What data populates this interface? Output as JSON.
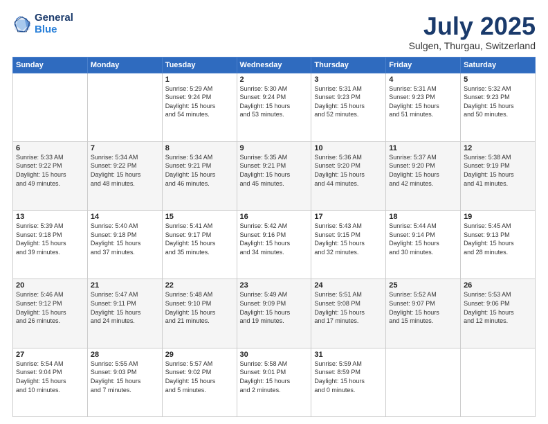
{
  "header": {
    "logo_line1": "General",
    "logo_line2": "Blue",
    "month": "July 2025",
    "location": "Sulgen, Thurgau, Switzerland"
  },
  "days_of_week": [
    "Sunday",
    "Monday",
    "Tuesday",
    "Wednesday",
    "Thursday",
    "Friday",
    "Saturday"
  ],
  "weeks": [
    [
      {
        "day": "",
        "info": ""
      },
      {
        "day": "",
        "info": ""
      },
      {
        "day": "1",
        "info": "Sunrise: 5:29 AM\nSunset: 9:24 PM\nDaylight: 15 hours\nand 54 minutes."
      },
      {
        "day": "2",
        "info": "Sunrise: 5:30 AM\nSunset: 9:24 PM\nDaylight: 15 hours\nand 53 minutes."
      },
      {
        "day": "3",
        "info": "Sunrise: 5:31 AM\nSunset: 9:23 PM\nDaylight: 15 hours\nand 52 minutes."
      },
      {
        "day": "4",
        "info": "Sunrise: 5:31 AM\nSunset: 9:23 PM\nDaylight: 15 hours\nand 51 minutes."
      },
      {
        "day": "5",
        "info": "Sunrise: 5:32 AM\nSunset: 9:23 PM\nDaylight: 15 hours\nand 50 minutes."
      }
    ],
    [
      {
        "day": "6",
        "info": "Sunrise: 5:33 AM\nSunset: 9:22 PM\nDaylight: 15 hours\nand 49 minutes."
      },
      {
        "day": "7",
        "info": "Sunrise: 5:34 AM\nSunset: 9:22 PM\nDaylight: 15 hours\nand 48 minutes."
      },
      {
        "day": "8",
        "info": "Sunrise: 5:34 AM\nSunset: 9:21 PM\nDaylight: 15 hours\nand 46 minutes."
      },
      {
        "day": "9",
        "info": "Sunrise: 5:35 AM\nSunset: 9:21 PM\nDaylight: 15 hours\nand 45 minutes."
      },
      {
        "day": "10",
        "info": "Sunrise: 5:36 AM\nSunset: 9:20 PM\nDaylight: 15 hours\nand 44 minutes."
      },
      {
        "day": "11",
        "info": "Sunrise: 5:37 AM\nSunset: 9:20 PM\nDaylight: 15 hours\nand 42 minutes."
      },
      {
        "day": "12",
        "info": "Sunrise: 5:38 AM\nSunset: 9:19 PM\nDaylight: 15 hours\nand 41 minutes."
      }
    ],
    [
      {
        "day": "13",
        "info": "Sunrise: 5:39 AM\nSunset: 9:18 PM\nDaylight: 15 hours\nand 39 minutes."
      },
      {
        "day": "14",
        "info": "Sunrise: 5:40 AM\nSunset: 9:18 PM\nDaylight: 15 hours\nand 37 minutes."
      },
      {
        "day": "15",
        "info": "Sunrise: 5:41 AM\nSunset: 9:17 PM\nDaylight: 15 hours\nand 35 minutes."
      },
      {
        "day": "16",
        "info": "Sunrise: 5:42 AM\nSunset: 9:16 PM\nDaylight: 15 hours\nand 34 minutes."
      },
      {
        "day": "17",
        "info": "Sunrise: 5:43 AM\nSunset: 9:15 PM\nDaylight: 15 hours\nand 32 minutes."
      },
      {
        "day": "18",
        "info": "Sunrise: 5:44 AM\nSunset: 9:14 PM\nDaylight: 15 hours\nand 30 minutes."
      },
      {
        "day": "19",
        "info": "Sunrise: 5:45 AM\nSunset: 9:13 PM\nDaylight: 15 hours\nand 28 minutes."
      }
    ],
    [
      {
        "day": "20",
        "info": "Sunrise: 5:46 AM\nSunset: 9:12 PM\nDaylight: 15 hours\nand 26 minutes."
      },
      {
        "day": "21",
        "info": "Sunrise: 5:47 AM\nSunset: 9:11 PM\nDaylight: 15 hours\nand 24 minutes."
      },
      {
        "day": "22",
        "info": "Sunrise: 5:48 AM\nSunset: 9:10 PM\nDaylight: 15 hours\nand 21 minutes."
      },
      {
        "day": "23",
        "info": "Sunrise: 5:49 AM\nSunset: 9:09 PM\nDaylight: 15 hours\nand 19 minutes."
      },
      {
        "day": "24",
        "info": "Sunrise: 5:51 AM\nSunset: 9:08 PM\nDaylight: 15 hours\nand 17 minutes."
      },
      {
        "day": "25",
        "info": "Sunrise: 5:52 AM\nSunset: 9:07 PM\nDaylight: 15 hours\nand 15 minutes."
      },
      {
        "day": "26",
        "info": "Sunrise: 5:53 AM\nSunset: 9:06 PM\nDaylight: 15 hours\nand 12 minutes."
      }
    ],
    [
      {
        "day": "27",
        "info": "Sunrise: 5:54 AM\nSunset: 9:04 PM\nDaylight: 15 hours\nand 10 minutes."
      },
      {
        "day": "28",
        "info": "Sunrise: 5:55 AM\nSunset: 9:03 PM\nDaylight: 15 hours\nand 7 minutes."
      },
      {
        "day": "29",
        "info": "Sunrise: 5:57 AM\nSunset: 9:02 PM\nDaylight: 15 hours\nand 5 minutes."
      },
      {
        "day": "30",
        "info": "Sunrise: 5:58 AM\nSunset: 9:01 PM\nDaylight: 15 hours\nand 2 minutes."
      },
      {
        "day": "31",
        "info": "Sunrise: 5:59 AM\nSunset: 8:59 PM\nDaylight: 15 hours\nand 0 minutes."
      },
      {
        "day": "",
        "info": ""
      },
      {
        "day": "",
        "info": ""
      }
    ]
  ]
}
